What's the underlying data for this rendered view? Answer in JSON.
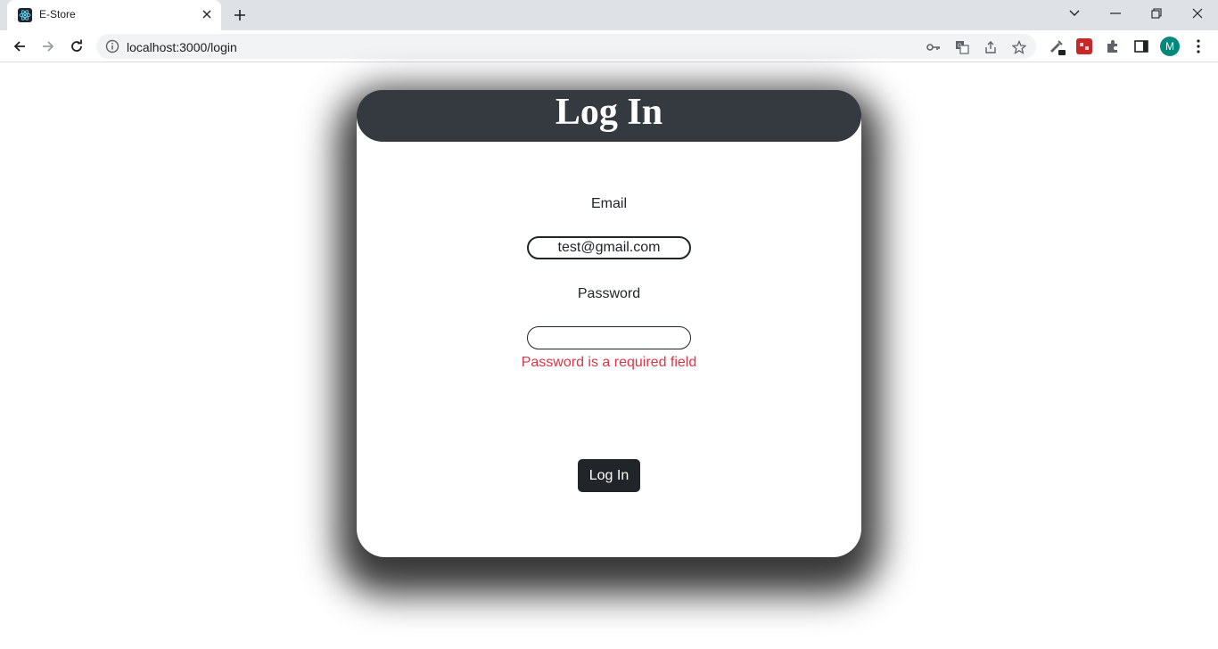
{
  "browser": {
    "tab": {
      "title": "E-Store",
      "favicon": "react-icon"
    },
    "address": {
      "url": "localhost:3000/login"
    },
    "profile_initial": "M"
  },
  "login_card": {
    "title": "Log In",
    "email_label": "Email",
    "email_value": "test@gmail.com",
    "password_label": "Password",
    "password_value": "",
    "password_error": "Password is a required field",
    "submit_label": "Log In"
  },
  "colors": {
    "header_bg": "#343a40",
    "button_bg": "#212529",
    "error_text": "#dc3545",
    "avatar_bg": "#00897b"
  }
}
